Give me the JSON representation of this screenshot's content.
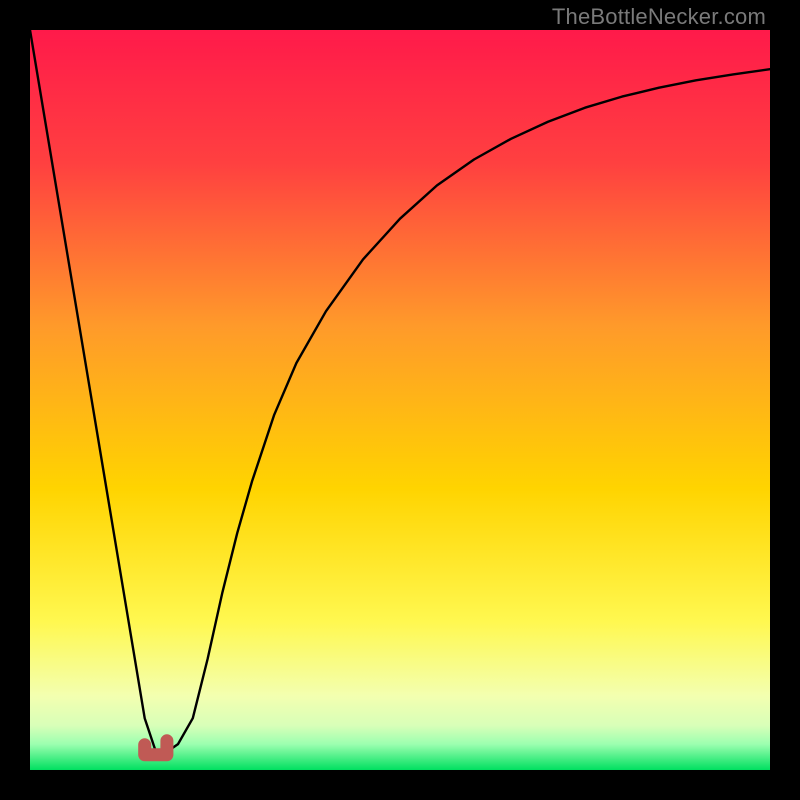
{
  "watermark": "TheBottleNecker.com",
  "colors": {
    "gradient_top": "#ff1a4a",
    "gradient_upper_mid": "#ff7a2a",
    "gradient_mid": "#ffd400",
    "gradient_lower_mid": "#f3ff4a",
    "gradient_band": "#eaffb0",
    "gradient_bottom": "#00e060",
    "curve": "#000000",
    "marker": "#c05a55",
    "frame": "#000000"
  },
  "chart_data": {
    "type": "line",
    "title": "",
    "xlabel": "",
    "ylabel": "",
    "xlim": [
      0,
      100
    ],
    "ylim": [
      0,
      100
    ],
    "grid": false,
    "legend": false,
    "series": [
      {
        "name": "bottleneck-curve",
        "x": [
          0,
          2,
          4,
          6,
          8,
          10,
          12,
          14,
          15.5,
          17,
          18,
          19,
          20,
          22,
          24,
          26,
          28,
          30,
          33,
          36,
          40,
          45,
          50,
          55,
          60,
          65,
          70,
          75,
          80,
          85,
          90,
          95,
          100
        ],
        "y": [
          100,
          88,
          76,
          64,
          52,
          40,
          28,
          16,
          7,
          2.5,
          2.5,
          2.8,
          3.5,
          7,
          15,
          24,
          32,
          39,
          48,
          55,
          62,
          69,
          74.5,
          79,
          82.5,
          85.3,
          87.6,
          89.5,
          91,
          92.2,
          93.2,
          94,
          94.7
        ]
      }
    ],
    "markers": [
      {
        "name": "min-region-start",
        "x": 15.5,
        "y": 2.6
      },
      {
        "name": "min-region-end",
        "x": 18.5,
        "y": 2.6
      }
    ],
    "annotations": []
  }
}
